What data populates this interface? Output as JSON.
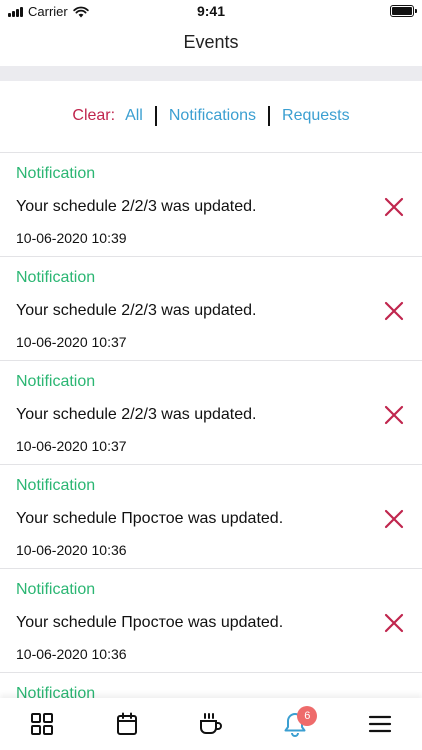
{
  "status_bar": {
    "carrier": "Carrier",
    "time": "9:41"
  },
  "header": {
    "title": "Events"
  },
  "filter": {
    "clear_label": "Clear:",
    "all_label": "All",
    "notifications_label": "Notifications",
    "requests_label": "Requests"
  },
  "colors": {
    "notification_type": "#2bb673",
    "clear": "#c0264e",
    "link": "#3b9fd1",
    "badge": "#ee6b6b",
    "active_tab": "#3b9fd1"
  },
  "events": [
    {
      "type": "Notification",
      "message": "Your schedule 2/2/3 was updated.",
      "time": "10-06-2020 10:39"
    },
    {
      "type": "Notification",
      "message": "Your schedule 2/2/3 was updated.",
      "time": "10-06-2020 10:37"
    },
    {
      "type": "Notification",
      "message": "Your schedule 2/2/3 was updated.",
      "time": "10-06-2020 10:37"
    },
    {
      "type": "Notification",
      "message": "Your schedule Простое was updated.",
      "time": "10-06-2020 10:36"
    },
    {
      "type": "Notification",
      "message": "Your schedule Простое was updated.",
      "time": "10-06-2020 10:36"
    },
    {
      "type": "Notification",
      "message": "",
      "time": ""
    }
  ],
  "tabbar": {
    "tabs": [
      {
        "icon": "grid-icon"
      },
      {
        "icon": "calendar-icon"
      },
      {
        "icon": "coffee-cup-icon"
      },
      {
        "icon": "bell-icon",
        "badge": "6",
        "active": true
      },
      {
        "icon": "menu-icon"
      }
    ]
  }
}
